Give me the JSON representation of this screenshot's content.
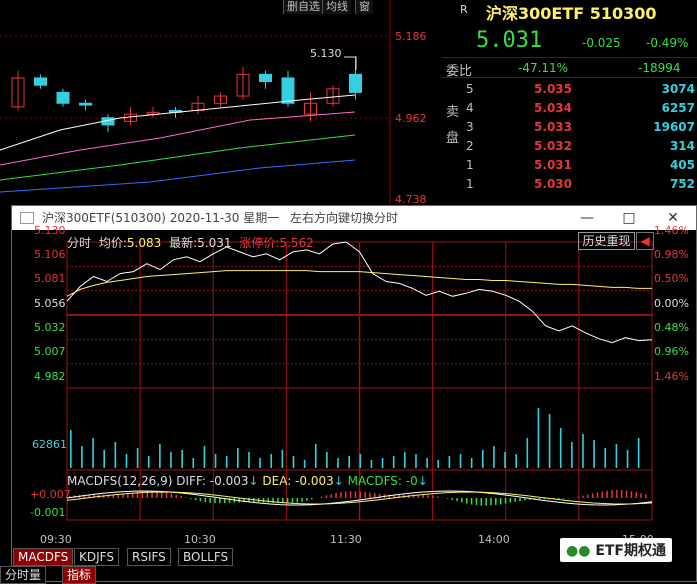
{
  "background_window": {
    "toolbar": [
      "删自选",
      "均线",
      "窗"
    ],
    "price_labels": [
      "5.186",
      "4.962",
      "4.738"
    ],
    "high_marker": "5.130",
    "candles": [
      {
        "o": 4.99,
        "c": 5.07,
        "h": 5.09,
        "l": 4.98,
        "up": true
      },
      {
        "o": 5.07,
        "c": 5.05,
        "h": 5.08,
        "l": 5.04,
        "up": false
      },
      {
        "o": 5.03,
        "c": 5.0,
        "h": 5.04,
        "l": 4.99,
        "up": false
      },
      {
        "o": 5.0,
        "c": 4.995,
        "h": 5.01,
        "l": 4.98,
        "up": false
      },
      {
        "o": 4.96,
        "c": 4.94,
        "h": 4.97,
        "l": 4.92,
        "up": false
      },
      {
        "o": 4.95,
        "c": 4.97,
        "h": 4.99,
        "l": 4.94,
        "up": true
      },
      {
        "o": 4.97,
        "c": 4.975,
        "h": 4.99,
        "l": 4.96,
        "up": true
      },
      {
        "o": 4.98,
        "c": 4.975,
        "h": 4.99,
        "l": 4.96,
        "up": false
      },
      {
        "o": 4.98,
        "c": 5.0,
        "h": 5.02,
        "l": 4.97,
        "up": true
      },
      {
        "o": 5.0,
        "c": 5.02,
        "h": 5.03,
        "l": 4.99,
        "up": true
      },
      {
        "o": 5.02,
        "c": 5.08,
        "h": 5.1,
        "l": 5.01,
        "up": true
      },
      {
        "o": 5.08,
        "c": 5.06,
        "h": 5.09,
        "l": 5.04,
        "up": false
      },
      {
        "o": 5.07,
        "c": 5.0,
        "h": 5.09,
        "l": 4.99,
        "up": false
      },
      {
        "o": 4.97,
        "c": 5.0,
        "h": 5.03,
        "l": 4.95,
        "up": true
      },
      {
        "o": 5.0,
        "c": 5.04,
        "h": 5.05,
        "l": 4.99,
        "up": true
      },
      {
        "o": 5.03,
        "c": 5.08,
        "h": 5.13,
        "l": 5.01,
        "up": false
      }
    ]
  },
  "quote": {
    "marker": "R",
    "name": "沪深300ETF 510300",
    "price": "5.031",
    "change": "-0.025",
    "change_pct": "-0.49%",
    "weibi_label": "委比",
    "weibi_pct": "-47.11%",
    "weibi_diff": "-18994",
    "sell_label": "卖盘",
    "asks": [
      {
        "level": "5",
        "price": "5.035",
        "vol": "3074"
      },
      {
        "level": "4",
        "price": "5.034",
        "vol": "6257"
      },
      {
        "level": "3",
        "price": "5.033",
        "vol": "19607"
      },
      {
        "level": "2",
        "price": "5.032",
        "vol": "314"
      },
      {
        "level": "1",
        "price": "5.031",
        "vol": "405"
      },
      {
        "level": "1",
        "price": "5.030",
        "vol": "752"
      }
    ]
  },
  "window": {
    "title": "沪深300ETF(510300) 2020-11-30 星期一",
    "hint": "左右方向键切换分时",
    "legend": {
      "fenshi": "分时",
      "avg_label": "均价:",
      "avg_value": "5.083",
      "last_label": "最新:",
      "last_value": "5.031",
      "limit_label": "涨停价:",
      "limit_value": "5.562"
    },
    "history_btn": "历史重现",
    "y_left": [
      "5.130",
      "5.106",
      "5.081",
      "5.056",
      "5.032",
      "5.007",
      "4.982"
    ],
    "y_right": [
      "1.46%",
      "0.98%",
      "0.50%",
      "0.00%",
      "0.48%",
      "0.96%",
      "1.46%"
    ],
    "volume_label": "62861",
    "macd": {
      "title": "MACDFS(12,26,9)",
      "diff": "DIFF: -0.003",
      "dea": "DEA: -0.003",
      "macdfs": "MACDFS: -0",
      "y_top": "+0.007",
      "y_mid": "-0.001"
    },
    "x_labels": [
      "09:30",
      "10:30",
      "11:30",
      "14:00",
      "15:00"
    ],
    "tabs": [
      "MACDFS",
      "KDJFS",
      "RSIFS",
      "BOLLFS"
    ],
    "tabs2": [
      "分时量",
      "指标"
    ]
  },
  "logo": "ETF期权通",
  "chart_data": {
    "type": "line",
    "title": "",
    "x_range": [
      "09:30",
      "15:00"
    ],
    "ylim": [
      4.982,
      5.13
    ],
    "prev_close": 5.056,
    "series": [
      {
        "name": "",
        "values": [
          5.07,
          5.085,
          5.095,
          5.09,
          5.098,
          5.1,
          5.108,
          5.102,
          5.112,
          5.115,
          5.11,
          5.118,
          5.125,
          5.12,
          5.115,
          5.118,
          5.112,
          5.12,
          5.122,
          5.118,
          5.128,
          5.13,
          5.12,
          5.098,
          5.09,
          5.088,
          5.083,
          5.076,
          5.08,
          5.075,
          5.078,
          5.082,
          5.08,
          5.076,
          5.07,
          5.06,
          5.045,
          5.04,
          5.045,
          5.038,
          5.032,
          5.028,
          5.033,
          5.03,
          5.031
        ]
      },
      {
        "name": "",
        "values": [
          5.075,
          5.082,
          5.086,
          5.089,
          5.091,
          5.093,
          5.095,
          5.096,
          5.097,
          5.098,
          5.099,
          5.1,
          5.101,
          5.101,
          5.101,
          5.101,
          5.101,
          5.101,
          5.101,
          5.1,
          5.1,
          5.1,
          5.1,
          5.099,
          5.098,
          5.097,
          5.096,
          5.095,
          5.094,
          5.093,
          5.092,
          5.092,
          5.091,
          5.091,
          5.09,
          5.089,
          5.088,
          5.087,
          5.087,
          5.086,
          5.085,
          5.084,
          5.084,
          5.083,
          5.083
        ]
      }
    ]
  }
}
